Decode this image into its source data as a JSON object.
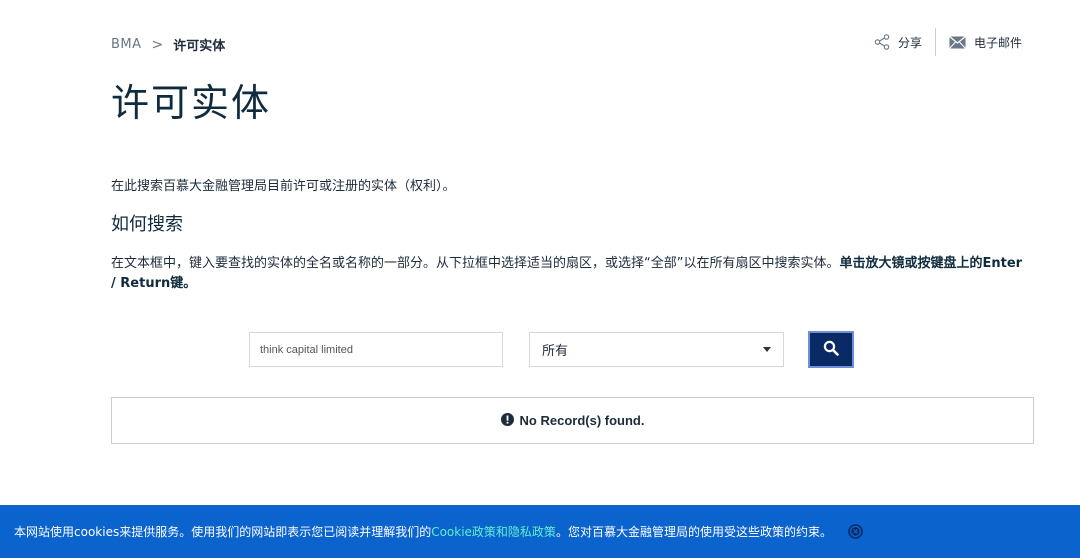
{
  "breadcrumb": {
    "root": "BMA",
    "separator": ">",
    "current": "许可实体"
  },
  "actions": {
    "share_label": "分享",
    "email_label": "电子邮件"
  },
  "page": {
    "title": "许可实体",
    "intro": "在此搜索百慕大金融管理局目前许可或注册的实体（权利）。",
    "how_title": "如何搜索",
    "instructions_plain": "在文本框中，键入要查找的实体的全名或名称的一部分。从下拉框中选择适当的扇区，或选择“全部”以在所有扇区中搜索实体。",
    "instructions_bold": "单击放大镜或按键盘上的Enter / Return键。"
  },
  "search": {
    "input_value": "think capital limited",
    "sector_selected": "所有",
    "button_icon": "magnifier-icon"
  },
  "results": {
    "message": "No Record(s) found.",
    "icon": "exclamation-circle-icon"
  },
  "cookie": {
    "text_before": "本网站使用cookies来提供服务。使用我们的网站即表示您已阅读并理解我们的",
    "link_text": "Cookie政策和隐私政策",
    "text_after": "。您对百慕大金融管理局的使用受这些政策的约束。",
    "close_icon": "close-circle-icon"
  },
  "colors": {
    "brand_dark": "#0a2a66",
    "cookie_bar": "#0b63ce",
    "cookie_link": "#5ef0d0",
    "title": "#0f2b3d"
  }
}
